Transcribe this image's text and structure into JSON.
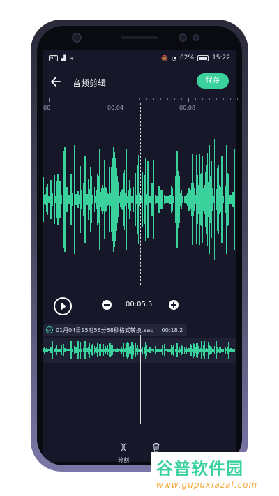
{
  "statusbar": {
    "left_tag": "HD",
    "battery": "82%",
    "time": "15:22"
  },
  "header": {
    "title": "音频剪辑",
    "save_label": "保存"
  },
  "timeline": {
    "labels": [
      "00",
      "00:04",
      "00:08"
    ]
  },
  "controls": {
    "timecode": "00:05.5"
  },
  "track": {
    "filename": "01月04日15时56分58秒格式转换.aac",
    "duration": "00:18.2"
  },
  "actions": {
    "split_label": "分割",
    "delete_label": "删除"
  },
  "watermark": {
    "title": "谷普软件园",
    "url": "www.gupuxlazal.com"
  },
  "colors": {
    "accent": "#3bd19c",
    "background": "#161829"
  }
}
